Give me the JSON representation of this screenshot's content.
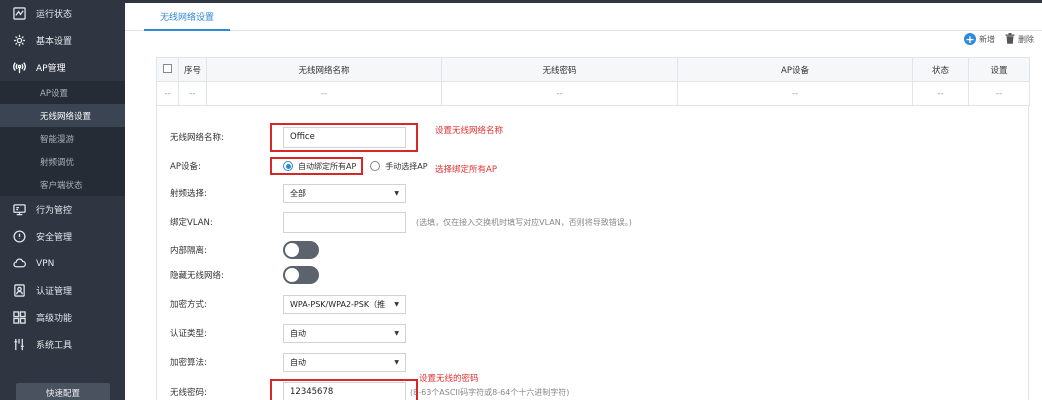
{
  "sidebar": {
    "items": [
      {
        "label": "运行状态",
        "icon": "chart-line-icon"
      },
      {
        "label": "基本设置",
        "icon": "gear-icon"
      },
      {
        "label": "AP管理",
        "icon": "wireless-ap-icon"
      },
      {
        "label": "行为管控",
        "icon": "monitor-icon"
      },
      {
        "label": "安全管理",
        "icon": "shield-icon"
      },
      {
        "label": "VPN",
        "icon": "cloud-icon"
      },
      {
        "label": "认证管理",
        "icon": "user-card-icon"
      },
      {
        "label": "高级功能",
        "icon": "grid-icon"
      },
      {
        "label": "系统工具",
        "icon": "tools-icon"
      }
    ],
    "ap_sub_items": [
      {
        "label": "AP设置"
      },
      {
        "label": "无线网络设置"
      },
      {
        "label": "智能漫游"
      },
      {
        "label": "射频调优"
      },
      {
        "label": "客户端状态"
      }
    ],
    "quick_config": "快速配置"
  },
  "tabs": [
    {
      "label": "无线网络设置"
    }
  ],
  "toolbar": {
    "add_label": "新增",
    "delete_label": "删除"
  },
  "table": {
    "headers": [
      "序号",
      "无线网络名称",
      "无线密码",
      "AP设备",
      "状态",
      "设置"
    ],
    "empty_row": [
      "--",
      "--",
      "--",
      "--",
      "--",
      "--",
      "--"
    ]
  },
  "form": {
    "ssid": {
      "label": "无线网络名称:",
      "value": "Office"
    },
    "ap_device": {
      "label": "AP设备:",
      "option_all": "自动绑定所有AP",
      "option_manual": "手动选择AP"
    },
    "radio_band": {
      "label": "射频选择:",
      "value": "全部"
    },
    "vlan": {
      "label": "绑定VLAN:",
      "value": "",
      "hint": "(选填，仅在接入交换机时填写对应VLAN，否则将导致错误。)"
    },
    "isolation": {
      "label": "内部隔离:"
    },
    "hide_ssid": {
      "label": "隐藏无线网络:"
    },
    "encryption": {
      "label": "加密方式:",
      "value": "WPA-PSK/WPA2-PSK（推"
    },
    "auth_type": {
      "label": "认证类型:",
      "value": "自动"
    },
    "cipher": {
      "label": "加密算法:",
      "value": "自动"
    },
    "password": {
      "label": "无线密码:",
      "value": "12345678",
      "hint": "(8-63个ASCII码字符或8-64个十六进制字符)"
    }
  },
  "annotations": {
    "ssid": "设置无线网络名称",
    "ap": "选择绑定所有AP",
    "password": "设置无线的密码"
  },
  "colors": {
    "sidebar_bg": "#2f3641",
    "accent": "#2f88d8",
    "annotation": "#e03131"
  }
}
